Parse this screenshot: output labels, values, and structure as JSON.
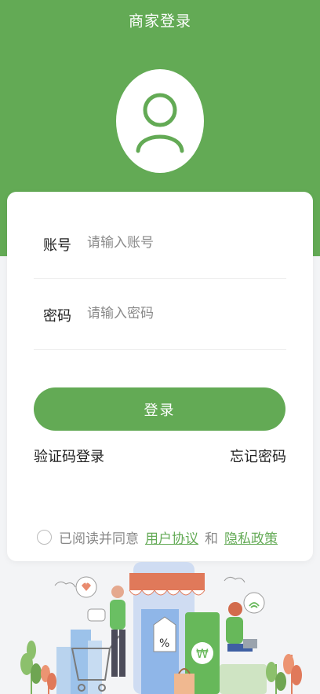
{
  "header": {
    "title": "商家登录"
  },
  "avatar": {
    "icon": "user-icon"
  },
  "form": {
    "account_label": "账号",
    "account_placeholder": "请输入账号",
    "account_value": "",
    "password_label": "密码",
    "password_placeholder": "请输入密码",
    "password_value": "",
    "login_button": "登录"
  },
  "links": {
    "sms_login": "验证码登录",
    "forgot_password": "忘记密码"
  },
  "agreement": {
    "prefix": "已阅读并同意",
    "user_agreement": "用户协议",
    "and": "和",
    "privacy_policy": "隐私政策",
    "checked": false
  },
  "colors": {
    "brand": "#63aa55",
    "background": "#f3f4f6"
  }
}
